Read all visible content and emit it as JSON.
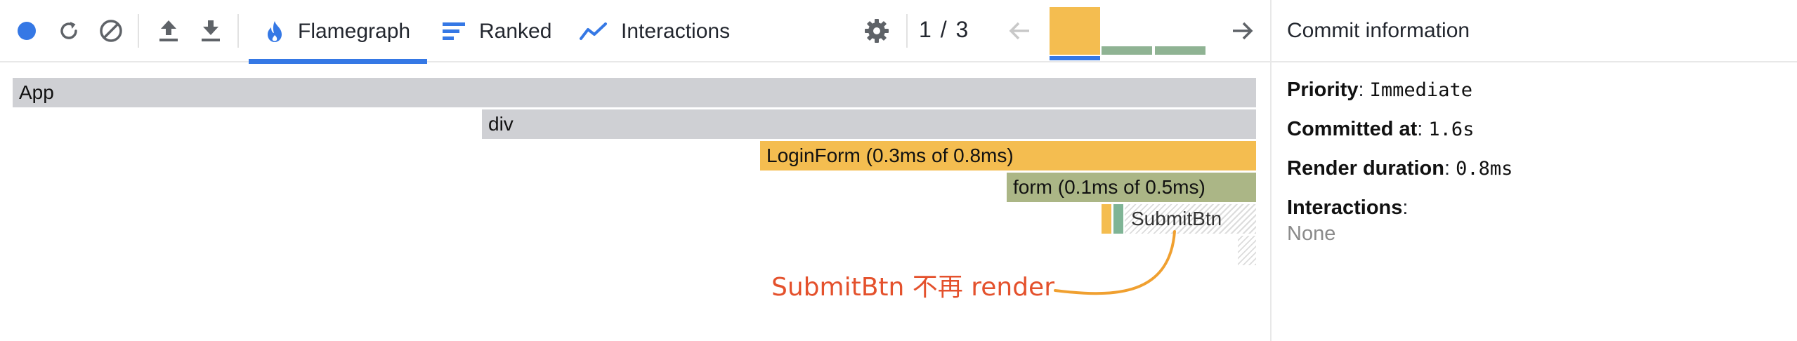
{
  "toolbar": {
    "record_icon": "record-dot-icon",
    "reload_icon": "reload-and-profile-icon",
    "clear_icon": "clear-profile-icon",
    "load_icon": "load-profile-icon",
    "save_icon": "save-profile-icon",
    "tabs": [
      {
        "label": "Flamegraph",
        "icon": "flame-icon",
        "selected": true
      },
      {
        "label": "Ranked",
        "icon": "ranked-bars-icon",
        "selected": false
      },
      {
        "label": "Interactions",
        "icon": "interactions-chart-icon",
        "selected": false
      }
    ],
    "settings_icon": "gear-icon",
    "commit_counter": "1 / 3",
    "prev_icon": "arrow-left-icon",
    "next_icon": "arrow-right-icon",
    "commit_bars": [
      {
        "level": 1.0,
        "color": "#f4bd50",
        "selected": true
      },
      {
        "level": 0.17,
        "color": "#8fb393",
        "selected": false
      },
      {
        "level": 0.17,
        "color": "#8fb393",
        "selected": false
      }
    ]
  },
  "colors": {
    "accent": "#3578e5",
    "rendered_slow": "#f4bd50",
    "rendered_fast": "#abb686",
    "not_rendered": "#cfd0d4",
    "annotation": "#e4512c"
  },
  "flamegraph": {
    "nodes": [
      {
        "label": "App"
      },
      {
        "label": "div"
      },
      {
        "label": "LoginForm (0.3ms of 0.8ms)"
      },
      {
        "label": "form (0.1ms of 0.5ms)"
      },
      {
        "label": "SubmitBtn"
      }
    ],
    "annotation": "SubmitBtn 不再 render"
  },
  "commit_info": {
    "title": "Commit information",
    "priority_label": "Priority",
    "priority_value": "Immediate",
    "committed_label": "Committed at",
    "committed_value": "1.6s",
    "duration_label": "Render duration",
    "duration_value": "0.8ms",
    "interactions_label": "Interactions",
    "interactions_value": "None"
  }
}
